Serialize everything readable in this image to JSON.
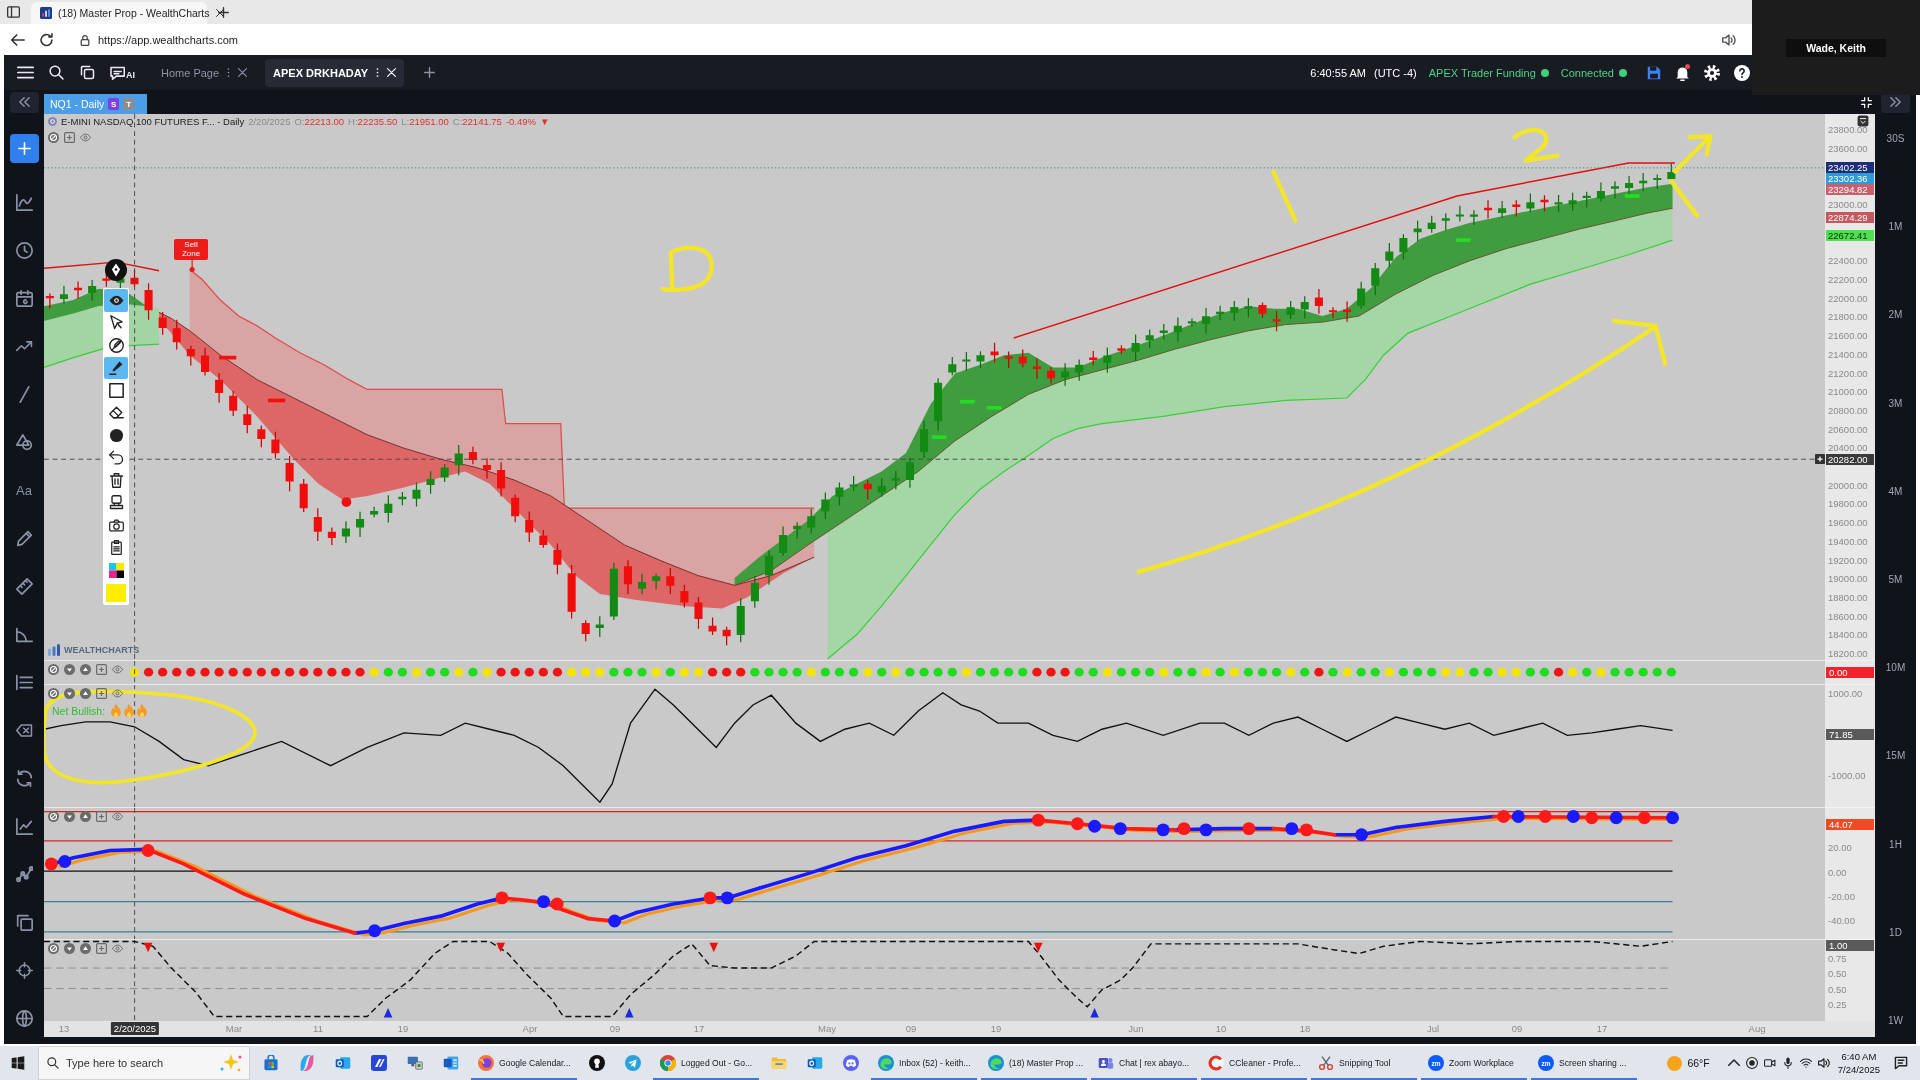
{
  "browser": {
    "tab_title": "(18) Master Prop - WealthCharts",
    "url": "https://app.wealthcharts.com"
  },
  "participant": {
    "name": "Wade, Keith"
  },
  "app_toolbar": {
    "ai_label": "AI",
    "tabs": [
      {
        "label": "Home Page",
        "selected": false
      },
      {
        "label": "APEX DRKHADAY",
        "selected": true
      }
    ],
    "clock": "6:40:55 AM",
    "timezone": "(UTC -4)",
    "statuses": [
      {
        "label": "APEX Trader Funding",
        "color": "#3fcf78"
      },
      {
        "label": "Connected",
        "color": "#3fcf78"
      }
    ],
    "notification_unread": true
  },
  "sidebar": {
    "tools": [
      {
        "kind": "indicators"
      },
      {
        "kind": "clock"
      },
      {
        "kind": "calendar"
      },
      {
        "kind": "trend"
      },
      {
        "kind": "line"
      },
      {
        "kind": "shapes"
      },
      {
        "kind": "text",
        "label": "Aa"
      },
      {
        "kind": "pencil"
      },
      {
        "kind": "ruler"
      },
      {
        "kind": "angle"
      },
      {
        "kind": "list"
      },
      {
        "kind": "erase"
      },
      {
        "kind": "sync"
      },
      {
        "kind": "chart"
      },
      {
        "kind": "nodes"
      },
      {
        "kind": "layers"
      },
      {
        "kind": "crosshair"
      },
      {
        "kind": "globe"
      }
    ]
  },
  "chart_tab": {
    "label": "NQ1 - Daily",
    "badges": [
      {
        "text": "S",
        "color": "#7b3fe4"
      },
      {
        "text": "T",
        "color": "#8d8d8d"
      }
    ]
  },
  "chart": {
    "header": {
      "title": "E-MINI NASDAQ 100 FUTURES F... - Daily",
      "date": "2/20/2025",
      "ohlc": [
        {
          "label": "O:",
          "value": "22213.00"
        },
        {
          "label": "H:",
          "value": "22235.50"
        },
        {
          "label": "L:",
          "value": "21951.00"
        },
        {
          "label": "C:",
          "value": "22141.75"
        }
      ],
      "change": "-0.49%",
      "arrow": "▼"
    },
    "controls": [
      {
        "kind": "disable"
      },
      {
        "kind": "add"
      },
      {
        "kind": "eye"
      }
    ],
    "sell_zone": "Sell Zone",
    "logo": "WEALTHCHARTS",
    "price_axis": [
      {
        "kind": "tick",
        "text": "23800.00"
      },
      {
        "kind": "tick",
        "text": "23600.00"
      },
      {
        "kind": "badge",
        "text": "23402.25",
        "color": "#1e2d78"
      },
      {
        "kind": "badge",
        "text": "23302.36",
        "color": "#2e9bd6"
      },
      {
        "kind": "badge",
        "text": "23294.82",
        "color": "#c9606e"
      },
      {
        "kind": "tick",
        "text": "23000.00"
      },
      {
        "kind": "badge",
        "text": "22874.29",
        "color": "#c5585c"
      },
      {
        "kind": "badge",
        "text": "22672.41",
        "color": "#4ee04e"
      },
      {
        "kind": "tick",
        "text": "22400.00"
      },
      {
        "kind": "tick",
        "text": "22200.00"
      },
      {
        "kind": "tick",
        "text": "22000.00"
      },
      {
        "kind": "tick",
        "text": "21800.00"
      },
      {
        "kind": "tick",
        "text": "21600.00"
      },
      {
        "kind": "tick",
        "text": "21400.00"
      },
      {
        "kind": "tick",
        "text": "21200.00"
      },
      {
        "kind": "tick",
        "text": "21000.00"
      },
      {
        "kind": "tick",
        "text": "20800.00"
      },
      {
        "kind": "tick",
        "text": "20600.00"
      },
      {
        "kind": "tick",
        "text": "20400.00"
      },
      {
        "kind": "crosshair",
        "text": "20282.00"
      },
      {
        "kind": "tick",
        "text": "20000.00"
      },
      {
        "kind": "tick",
        "text": "19800.00"
      },
      {
        "kind": "tick",
        "text": "19600.00"
      },
      {
        "kind": "tick",
        "text": "19400.00"
      },
      {
        "kind": "tick",
        "text": "19200.00"
      },
      {
        "kind": "tick",
        "text": "19000.00"
      },
      {
        "kind": "tick",
        "text": "18800.00"
      },
      {
        "kind": "tick",
        "text": "18600.00"
      },
      {
        "kind": "tick",
        "text": "18400.00"
      },
      {
        "kind": "tick",
        "text": "18200.00"
      }
    ],
    "panes": [
      {
        "kind": "dots",
        "controls": [
          {
            "kind": "disable"
          },
          {
            "kind": "down"
          },
          {
            "kind": "up"
          },
          {
            "kind": "add"
          },
          {
            "kind": "eye"
          }
        ],
        "axis": [
          {
            "kind": "badge",
            "text": "0.00",
            "color": "#f0232d"
          }
        ]
      },
      {
        "kind": "oscillator",
        "controls": [
          {
            "kind": "disable"
          },
          {
            "kind": "down"
          },
          {
            "kind": "up"
          },
          {
            "kind": "add"
          },
          {
            "kind": "eye"
          }
        ],
        "legend": {
          "label": "Net Bullish:",
          "icons": [
            {
              "kind": "flame"
            },
            {
              "kind": "flame"
            },
            {
              "kind": "flame"
            }
          ]
        },
        "axis": [
          {
            "kind": "tick",
            "text": "1000.00"
          },
          {
            "kind": "badge",
            "text": "71.85",
            "color": "#5a5a5a"
          },
          {
            "kind": "tick",
            "text": "-1000.00"
          }
        ]
      },
      {
        "kind": "crossover",
        "controls": [
          {
            "kind": "disable"
          },
          {
            "kind": "down"
          },
          {
            "kind": "up"
          },
          {
            "kind": "add"
          },
          {
            "kind": "eye"
          }
        ],
        "axis": [
          {
            "kind": "badge",
            "text": "44.07",
            "color": "#ef4a23"
          },
          {
            "kind": "tick",
            "text": "20.00"
          },
          {
            "kind": "tick",
            "text": "0.00"
          },
          {
            "kind": "tick",
            "text": "-20.00"
          },
          {
            "kind": "tick",
            "text": "-40.00"
          }
        ]
      },
      {
        "kind": "stepped",
        "controls": [
          {
            "kind": "disable"
          },
          {
            "kind": "down"
          },
          {
            "kind": "up"
          },
          {
            "kind": "add"
          },
          {
            "kind": "eye"
          }
        ],
        "axis": [
          {
            "kind": "badge",
            "text": "1.00",
            "color": "#5a5a5a"
          },
          {
            "kind": "tick",
            "text": "0.75"
          },
          {
            "kind": "tick",
            "text": "0.50"
          },
          {
            "kind": "tick",
            "text": "0.50"
          },
          {
            "kind": "tick",
            "text": "0.25"
          }
        ]
      }
    ],
    "time_axis": [
      {
        "kind": "tick",
        "text": "13"
      },
      {
        "kind": "crosshair",
        "text": "2/20/2025"
      },
      {
        "kind": "tick",
        "text": "Mar"
      },
      {
        "kind": "tick",
        "text": "11"
      },
      {
        "kind": "tick",
        "text": "19"
      },
      {
        "kind": "tick",
        "text": "Apr"
      },
      {
        "kind": "tick",
        "text": "09"
      },
      {
        "kind": "tick",
        "text": "17"
      },
      {
        "kind": "tick",
        "text": "May"
      },
      {
        "kind": "tick",
        "text": "09"
      },
      {
        "kind": "tick",
        "text": "19"
      },
      {
        "kind": "tick",
        "text": "Jun"
      },
      {
        "kind": "tick",
        "text": "10"
      },
      {
        "kind": "tick",
        "text": "18"
      },
      {
        "kind": "tick",
        "text": "Jul"
      },
      {
        "kind": "tick",
        "text": "09"
      },
      {
        "kind": "tick",
        "text": "17"
      },
      {
        "kind": "tick",
        "text": "Aug"
      }
    ]
  },
  "drawing_toolbar": {
    "tools": [
      {
        "kind": "eye",
        "selected": true
      },
      {
        "kind": "cursor",
        "selected": false
      },
      {
        "kind": "no-draw",
        "selected": false
      },
      {
        "kind": "highlighter",
        "selected": true
      },
      {
        "kind": "rectangle",
        "selected": false
      },
      {
        "kind": "eraser",
        "selected": false
      },
      {
        "kind": "dot",
        "selected": false
      },
      {
        "kind": "undo",
        "selected": false
      },
      {
        "kind": "trash",
        "selected": false
      },
      {
        "kind": "stamp",
        "selected": false
      },
      {
        "kind": "camera",
        "selected": false
      },
      {
        "kind": "clipboard",
        "selected": false
      },
      {
        "kind": "palette",
        "selected": false
      },
      {
        "kind": "swatch",
        "selected": false,
        "color": "#ffee00"
      }
    ]
  },
  "timeframes": [
    "30S",
    "1M",
    "2M",
    "3M",
    "4M",
    "5M",
    "10M",
    "15M",
    "1H",
    "1D",
    "1W"
  ],
  "taskbar": {
    "search_placeholder": "Type here to search",
    "apps": [
      {
        "kind": "bag",
        "running": false
      },
      {
        "kind": "swirl",
        "running": false
      },
      {
        "kind": "mail",
        "running": false
      },
      {
        "kind": "stripes",
        "running": false
      },
      {
        "kind": "computer",
        "running": false
      },
      {
        "kind": "document",
        "running": false
      },
      {
        "kind": "globe",
        "label": "Google Calendar...",
        "running": true
      },
      {
        "kind": "keyhole",
        "running": false
      },
      {
        "kind": "plane",
        "running": false
      },
      {
        "kind": "ring",
        "label": "Logged Out - Go...",
        "running": true
      },
      {
        "kind": "folder",
        "running": false
      },
      {
        "kind": "mail",
        "running": false
      },
      {
        "kind": "controller",
        "running": false
      },
      {
        "kind": "wave",
        "label": "Inbox (52) - keith...",
        "running": true
      },
      {
        "kind": "wave",
        "label": "(18) Master Prop ...",
        "running": true
      },
      {
        "kind": "people",
        "label": "Chat | rex abayo...",
        "running": true
      },
      {
        "kind": "c-ring",
        "label": "CCleaner - Profe...",
        "running": true
      },
      {
        "kind": "scissors",
        "label": "Snipping Tool",
        "running": true
      },
      {
        "kind": "logo",
        "logo_text": "zm",
        "label": "Zoom Workplace",
        "running": true
      },
      {
        "kind": "logo",
        "logo_text": "zm",
        "label": "Screen sharing ...",
        "running": true
      }
    ],
    "weather": "66°F",
    "time": "6:40 AM",
    "date": "7/24/2025"
  }
}
